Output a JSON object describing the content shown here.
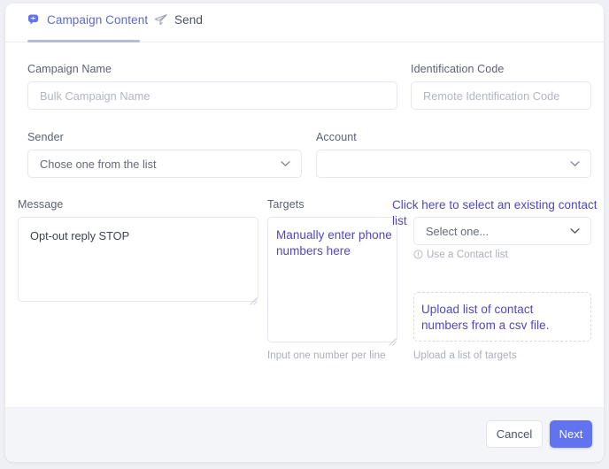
{
  "accent": "#6173f0",
  "annotation_color": "#4f46c8",
  "tabs": [
    {
      "label": "Campaign Content",
      "icon": "chat-bubble-icon",
      "active": true
    },
    {
      "label": "Send",
      "icon": "paper-plane-icon",
      "active": false
    }
  ],
  "form": {
    "campaign_name": {
      "label": "Campaign Name",
      "value": "",
      "placeholder": "Bulk Campaign Name"
    },
    "identification_code": {
      "label": "Identification Code",
      "value": "",
      "placeholder": "Remote Identification Code"
    },
    "sender": {
      "label": "Sender",
      "value": "Chose one from the list"
    },
    "account": {
      "label": "Account",
      "value": ""
    },
    "message": {
      "label": "Message",
      "value": "Opt-out reply STOP"
    },
    "targets": {
      "label": "Targets",
      "value": "",
      "helper": "Input one number per line",
      "annotation": "Manually enter phone numbers here"
    },
    "contact_list": {
      "annotation": "Click here to select an existing contact list",
      "value": "Select one...",
      "helper": "Use a Contact list",
      "helper_icon": "info-circle-icon"
    },
    "upload": {
      "annotation": "Upload list of contact numbers from a csv file.",
      "helper": "Upload a list of targets"
    }
  },
  "footer": {
    "cancel_label": "Cancel",
    "next_label": "Next"
  }
}
